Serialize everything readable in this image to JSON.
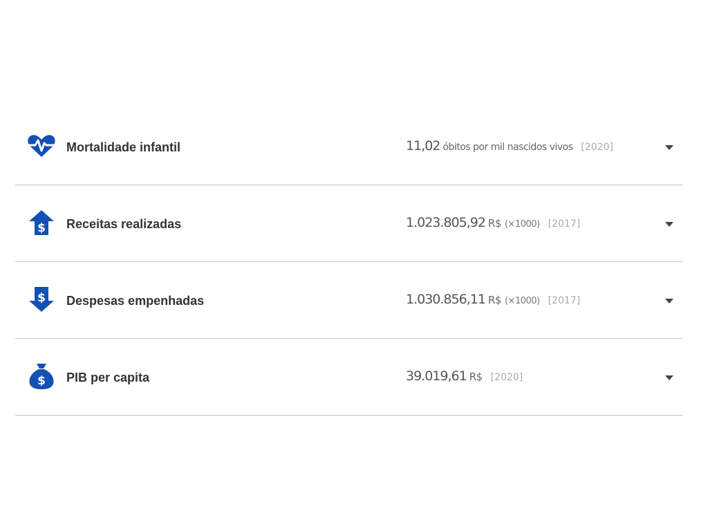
{
  "colors": {
    "icon_blue": "#1351b4",
    "divider": "#c4c4c4",
    "label_text": "#333333",
    "year_text": "#aaaaaa"
  },
  "indicators": [
    {
      "icon": "heart-pulse-icon",
      "name": "Mortalidade infantil",
      "value": "11,02",
      "unit": "óbitos por mil nascidos vivos",
      "multiplier": "",
      "year": "[2020]"
    },
    {
      "icon": "revenue-up-arrow-dollar-icon",
      "name": "Receitas realizadas",
      "value": "1.023.805,92",
      "unit": "R$",
      "multiplier": "(×1000)",
      "year": "[2017]"
    },
    {
      "icon": "expense-down-arrow-dollar-icon",
      "name": "Despesas empenhadas",
      "value": "1.030.856,11",
      "unit": "R$",
      "multiplier": "(×1000)",
      "year": "[2017]"
    },
    {
      "icon": "money-bag-icon",
      "name": "PIB per capita",
      "value": "39.019,61",
      "unit": "R$",
      "multiplier": "",
      "year": "[2020]"
    }
  ]
}
